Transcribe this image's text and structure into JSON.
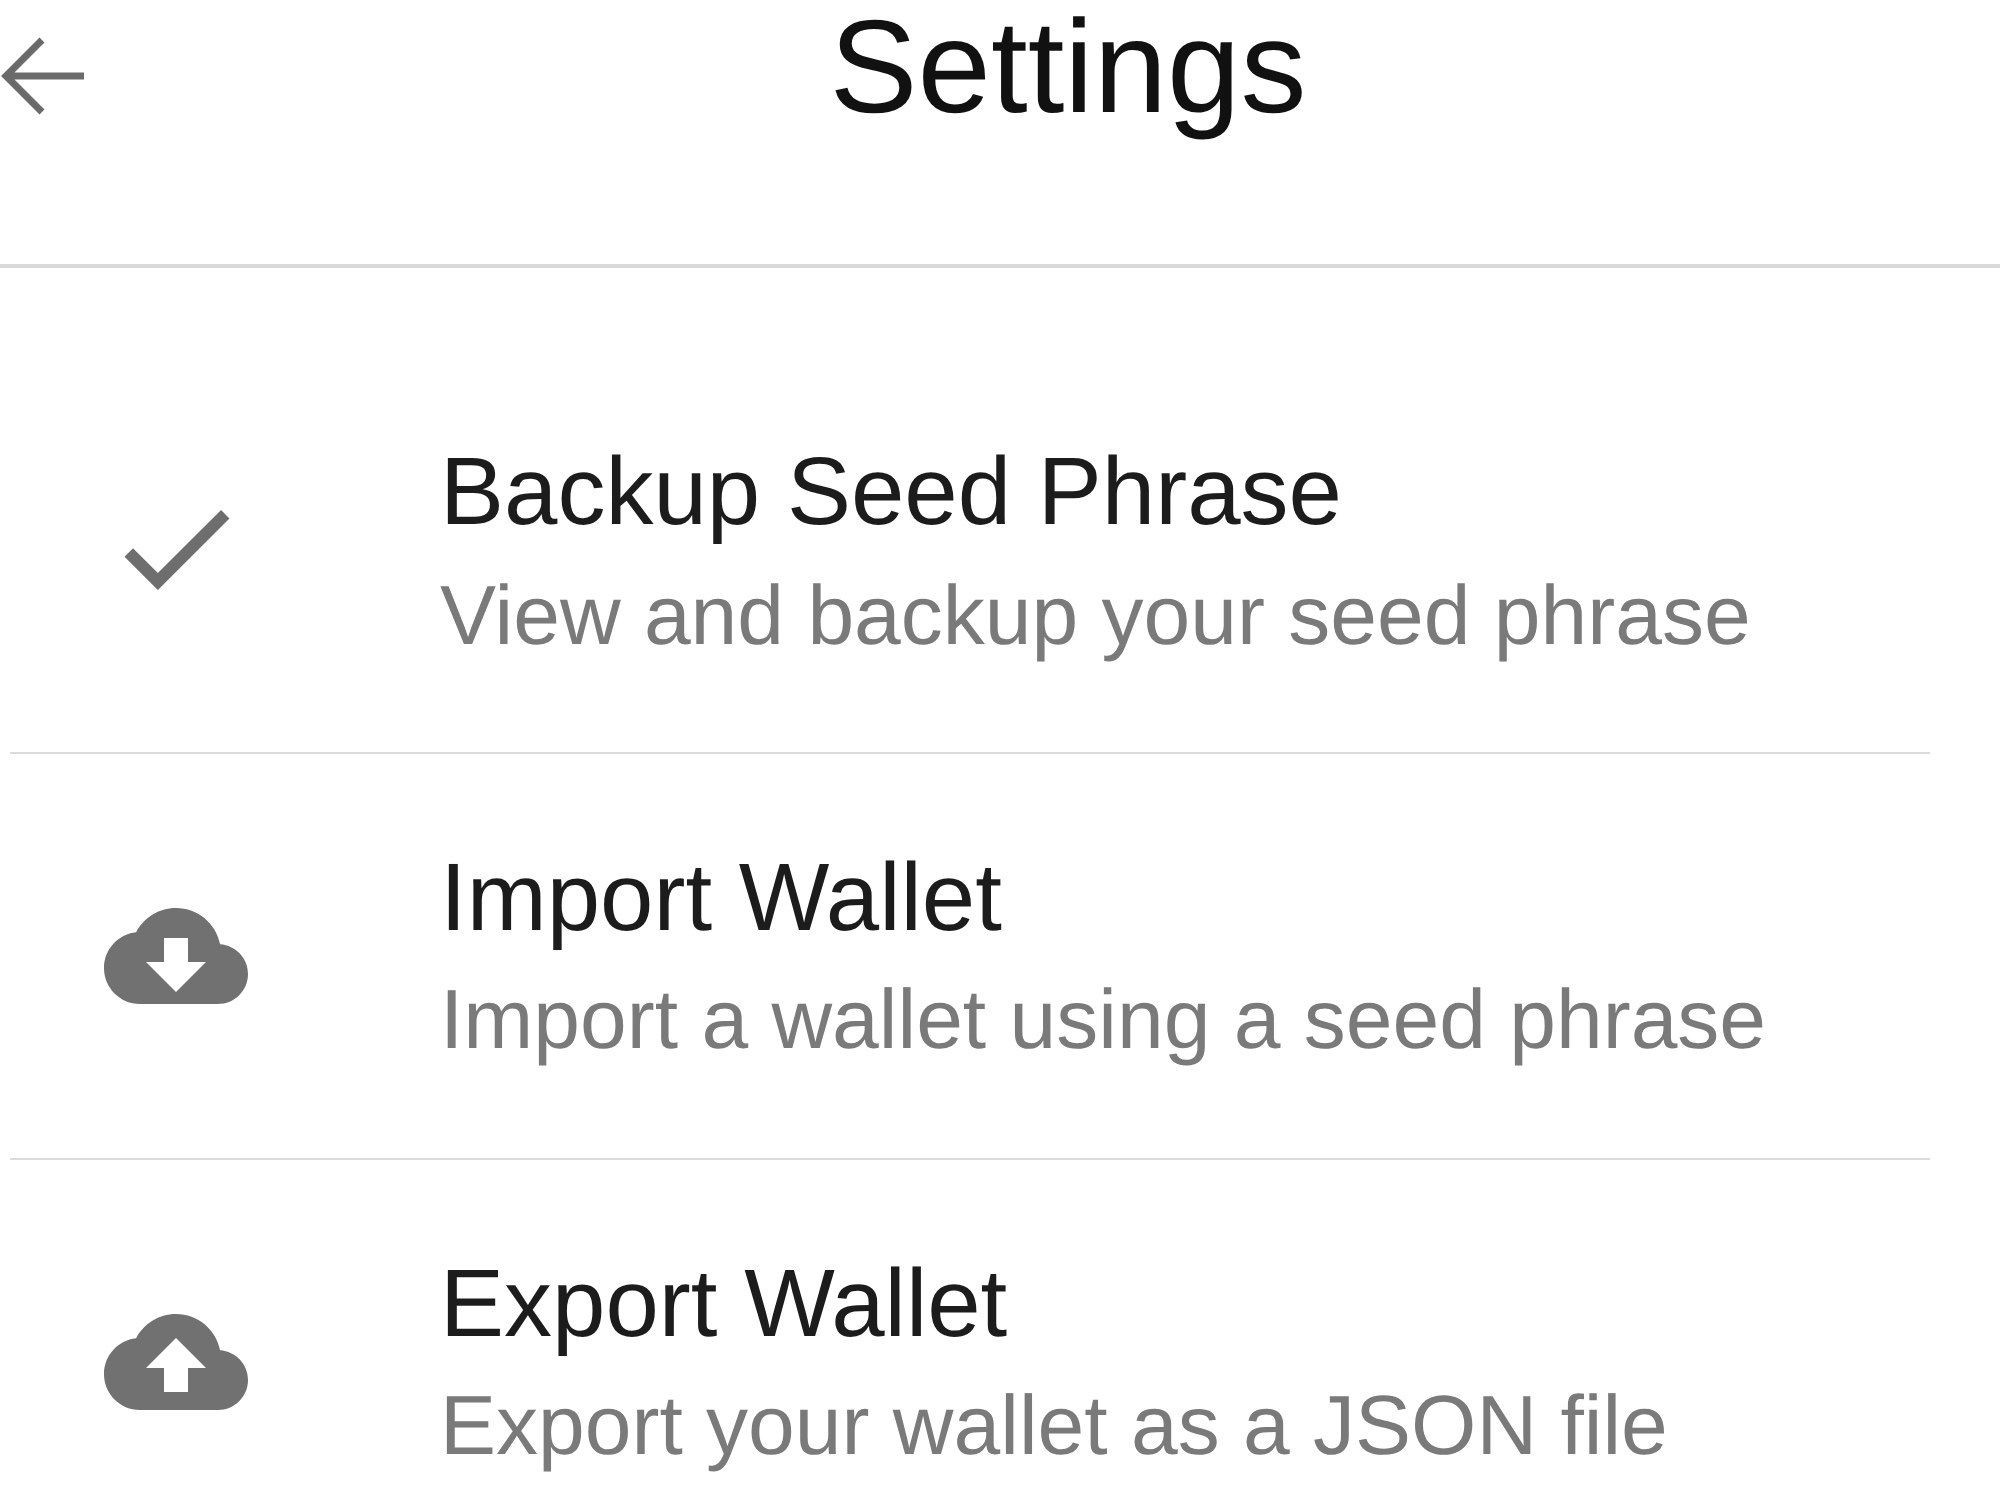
{
  "header": {
    "title": "Settings"
  },
  "items": [
    {
      "kind": "backup",
      "title": "Backup Seed Phrase",
      "subtitle": "View and backup your seed phrase"
    },
    {
      "kind": "import",
      "title": "Import Wallet",
      "subtitle": "Import a wallet using a seed phrase"
    },
    {
      "kind": "export",
      "title": "Export Wallet",
      "subtitle": "Export your wallet as a JSON file"
    }
  ]
}
